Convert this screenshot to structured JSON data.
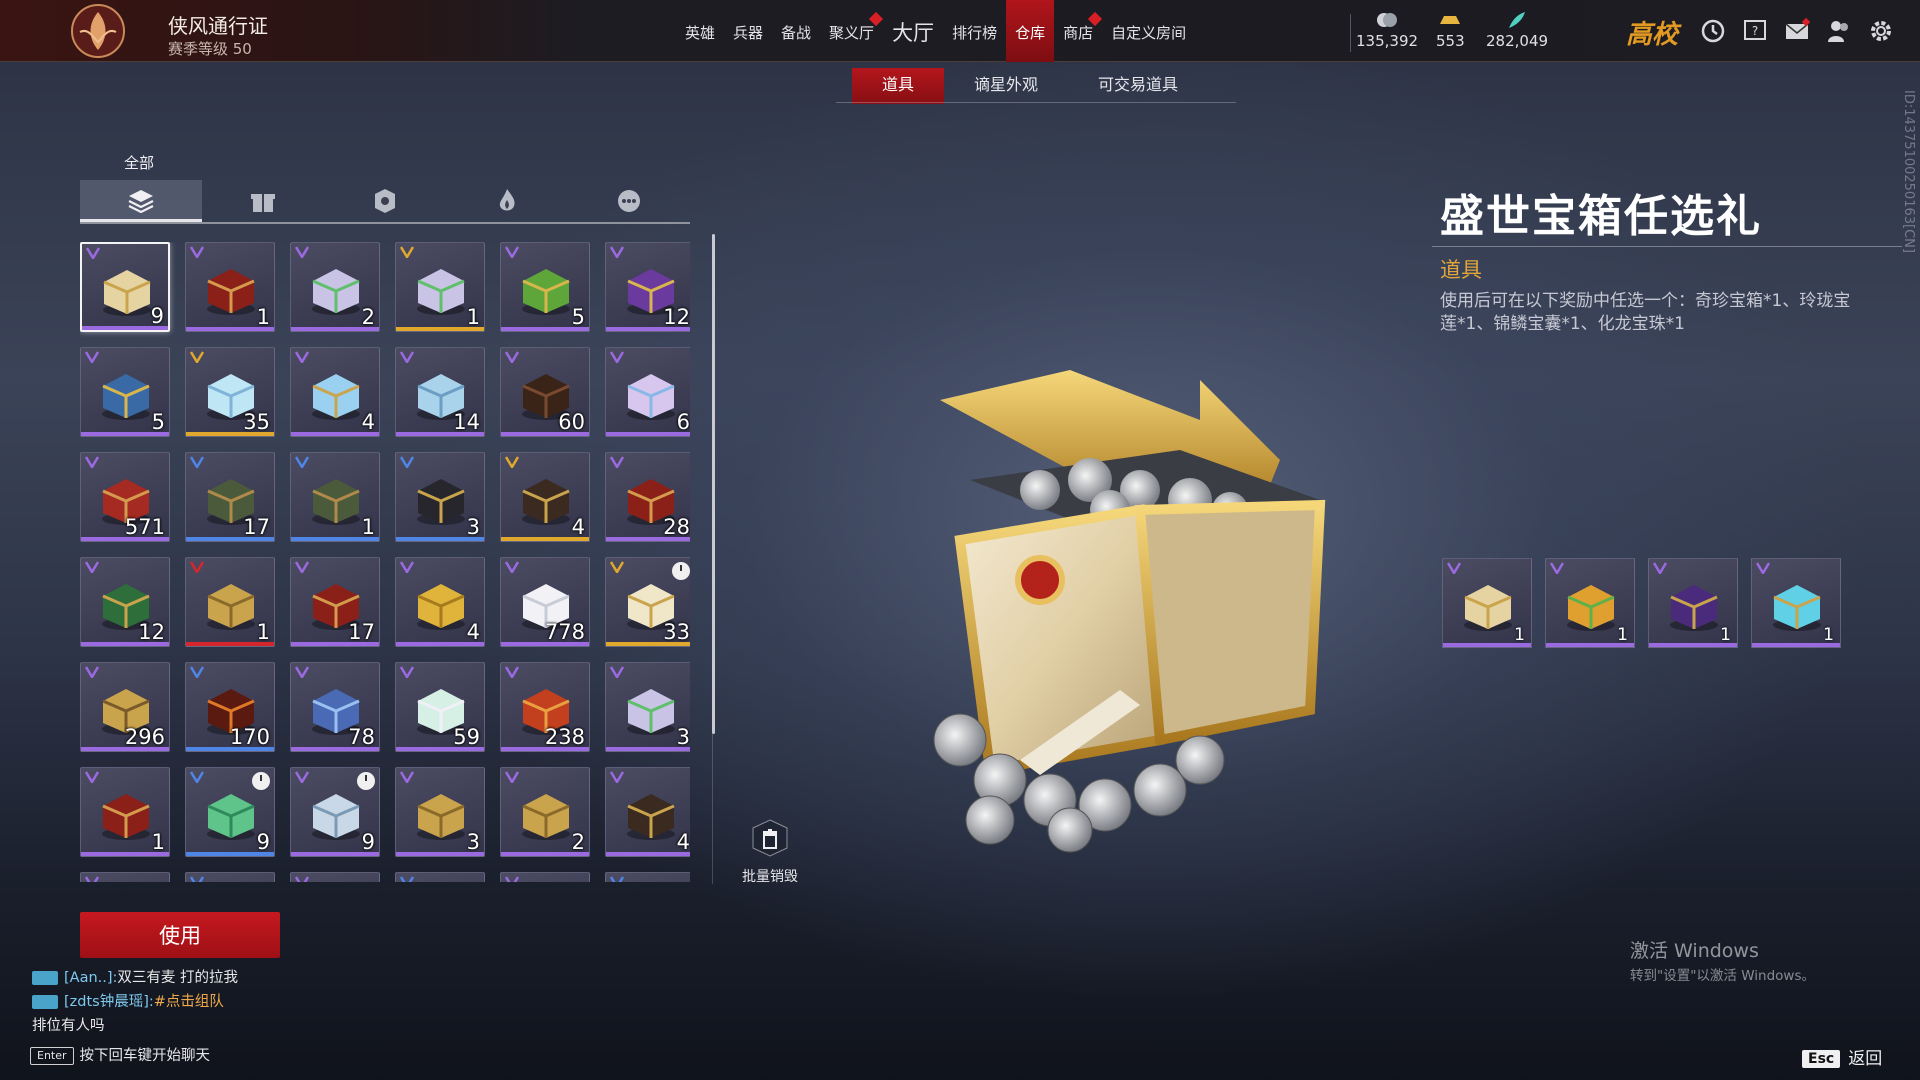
{
  "header": {
    "pass_title": "侠风通行证",
    "pass_level": "赛季等级 50",
    "nav": [
      {
        "label": "英雄",
        "badge": false,
        "big": false,
        "active": false
      },
      {
        "label": "兵器",
        "badge": false,
        "big": false,
        "active": false
      },
      {
        "label": "备战",
        "badge": false,
        "big": false,
        "active": false
      },
      {
        "label": "聚义厅",
        "badge": true,
        "big": false,
        "active": false
      },
      {
        "label": "大厅",
        "badge": false,
        "big": true,
        "active": false
      },
      {
        "label": "排行榜",
        "badge": false,
        "big": false,
        "active": false
      },
      {
        "label": "仓库",
        "badge": false,
        "big": false,
        "active": true
      },
      {
        "label": "商店",
        "badge": true,
        "big": false,
        "active": false
      },
      {
        "label": "自定义房间",
        "badge": false,
        "big": false,
        "active": false
      }
    ],
    "currencies": [
      {
        "icon": "coin-icon",
        "value": "135,392"
      },
      {
        "icon": "gold-ingot-icon",
        "value": "553"
      },
      {
        "icon": "jade-feather-icon",
        "value": "282,049"
      }
    ],
    "rank_logo": "高校",
    "icons": [
      "history-icon",
      "help-icon",
      "mail-icon",
      "friends-icon",
      "settings-icon"
    ]
  },
  "subtabs": [
    {
      "label": "道具",
      "active": true
    },
    {
      "label": "谪星外观",
      "active": false
    },
    {
      "label": "可交易道具",
      "active": false
    }
  ],
  "category": {
    "label": "全部",
    "icons": [
      "all-layers-icon",
      "gift-icon",
      "badge-icon",
      "flame-icon",
      "more-icon"
    ]
  },
  "inventory": [
    {
      "qty": "9",
      "rarity": "purple",
      "item": "treasure-chest",
      "selected": true
    },
    {
      "qty": "1",
      "rarity": "purple",
      "item": "red-chest"
    },
    {
      "qty": "2",
      "rarity": "purple",
      "item": "gift-box"
    },
    {
      "qty": "1",
      "rarity": "gold",
      "item": "gift-box"
    },
    {
      "qty": "5",
      "rarity": "purple",
      "item": "green-emblem"
    },
    {
      "qty": "12",
      "rarity": "purple",
      "item": "purple-emblem"
    },
    {
      "qty": "5",
      "rarity": "purple",
      "item": "blue-emblem"
    },
    {
      "qty": "35",
      "rarity": "gold",
      "item": "crystal"
    },
    {
      "qty": "4",
      "rarity": "purple",
      "item": "orb"
    },
    {
      "qty": "14",
      "rarity": "purple",
      "item": "ice-crystal"
    },
    {
      "qty": "60",
      "rarity": "purple",
      "item": "dark-box"
    },
    {
      "qty": "6",
      "rarity": "purple",
      "item": "feather"
    },
    {
      "qty": "571",
      "rarity": "purple",
      "item": "hammer"
    },
    {
      "qty": "17",
      "rarity": "blue",
      "item": "bronze-chest"
    },
    {
      "qty": "1",
      "rarity": "blue",
      "item": "bronze-chest"
    },
    {
      "qty": "3",
      "rarity": "blue",
      "item": "key-box"
    },
    {
      "qty": "4",
      "rarity": "gold",
      "item": "dark-chest"
    },
    {
      "qty": "28",
      "rarity": "purple",
      "item": "red-chest"
    },
    {
      "qty": "12",
      "rarity": "purple",
      "item": "jade-chest"
    },
    {
      "qty": "1",
      "rarity": "red",
      "item": "gold-chest"
    },
    {
      "qty": "17",
      "rarity": "purple",
      "item": "red-chest"
    },
    {
      "qty": "4",
      "rarity": "purple",
      "item": "gold-coin"
    },
    {
      "qty": "778",
      "rarity": "purple",
      "item": "pearl"
    },
    {
      "qty": "33",
      "rarity": "gold",
      "item": "key",
      "timed": true
    },
    {
      "qty": "296",
      "rarity": "purple",
      "item": "gold-token"
    },
    {
      "qty": "170",
      "rarity": "blue",
      "item": "demon-mask"
    },
    {
      "qty": "78",
      "rarity": "purple",
      "item": "blue-token"
    },
    {
      "qty": "59",
      "rarity": "purple",
      "item": "lotus"
    },
    {
      "qty": "238",
      "rarity": "purple",
      "item": "fire-stone"
    },
    {
      "qty": "3",
      "rarity": "purple",
      "item": "gift-box"
    },
    {
      "qty": "1",
      "rarity": "purple",
      "item": "red-chest"
    },
    {
      "qty": "9",
      "rarity": "blue",
      "item": "jade-lotus",
      "timed": true
    },
    {
      "qty": "9",
      "rarity": "purple",
      "item": "gourd",
      "timed": true
    },
    {
      "qty": "3",
      "rarity": "purple",
      "item": "gold-chest"
    },
    {
      "qty": "2",
      "rarity": "purple",
      "item": "gold-chest"
    },
    {
      "qty": "4",
      "rarity": "purple",
      "item": "dark-chest"
    }
  ],
  "bulk_destroy": "批量销毁",
  "use_button": "使用",
  "chat": [
    {
      "who": "[Aan..]:",
      "text": "双三有麦  打的拉我",
      "team": false
    },
    {
      "who": "[zdts钟晨瑶]:",
      "text": "#点击组队",
      "team": true
    },
    {
      "who": "",
      "text": "排位有人吗",
      "team": false
    }
  ],
  "chat_hint": {
    "key": "Enter",
    "text": "按下回车键开始聊天"
  },
  "detail": {
    "title": "盛世宝箱任选礼",
    "type": "道具",
    "description": "使用后可在以下奖励中任选一个：奇珍宝箱*1、玲珑宝莲*1、锦鳞宝囊*1、化龙宝珠*1",
    "rewards": [
      {
        "item": "treasure-chest",
        "qty": "1"
      },
      {
        "item": "golden-lotus",
        "qty": "1"
      },
      {
        "item": "silk-pouch",
        "qty": "1"
      },
      {
        "item": "dragon-pearl",
        "qty": "1"
      }
    ]
  },
  "id_text": "ID:143751002501​63[CN]",
  "windows": {
    "title": "激活 Windows",
    "sub": "转到\"设置\"以激活 Windows。"
  },
  "esc": {
    "key": "Esc",
    "label": "返回"
  },
  "rarity_colors": {
    "purple": "#9c6ae0",
    "blue": "#4f86e6",
    "gold": "#e0a92e",
    "red": "#d6262d"
  }
}
